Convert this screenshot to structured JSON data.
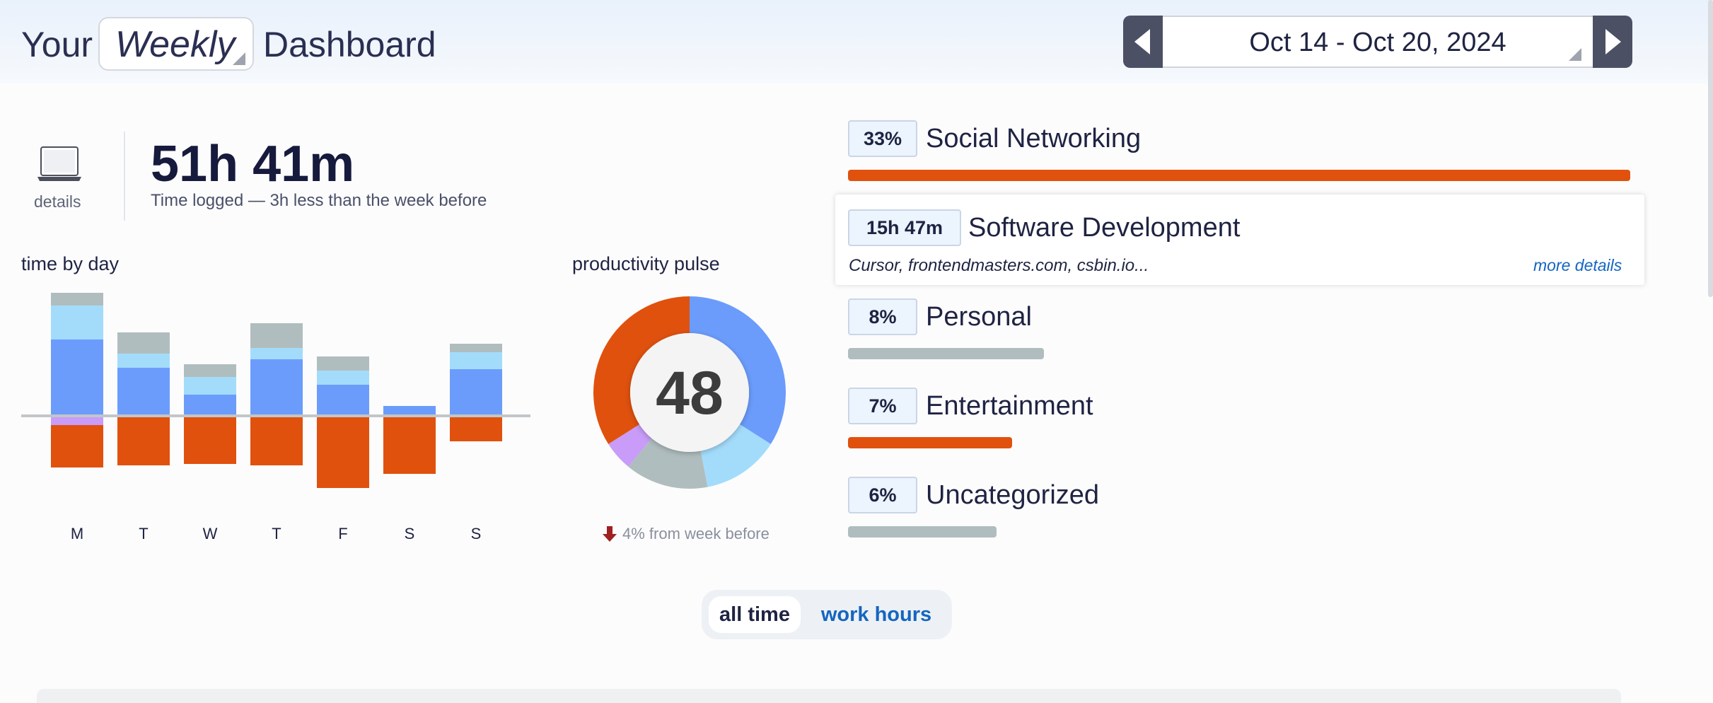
{
  "header": {
    "title_prefix": "Your",
    "period": "Weekly",
    "title_suffix": "Dashboard",
    "date_range": "Oct 14 - Oct 20, 2024",
    "prev_icon": "triangle-left-icon",
    "next_icon": "triangle-right-icon"
  },
  "summary": {
    "details_label": "details",
    "device_icon": "laptop-icon",
    "total_time": "51h 41m",
    "note": "Time logged — 3h less than the week before"
  },
  "time_by_day": {
    "label": "time by day",
    "days": [
      "M",
      "T",
      "W",
      "T",
      "F",
      "S",
      "S"
    ]
  },
  "pulse": {
    "label": "productivity pulse",
    "score": "48",
    "change_note": "4% from week before",
    "change_icon": "arrow-down-icon"
  },
  "colors": {
    "very_productive": "#6b9cfc",
    "productive": "#a3dcfb",
    "neutral": "#b0bdbe",
    "distracting": "#c89cf8",
    "very_distracting": "#e0510e",
    "link": "#1565c0"
  },
  "categories": [
    {
      "value": "33%",
      "name": "Social Networking",
      "level": 1.0,
      "color": "#e0510e"
    },
    {
      "value": "15h 47m",
      "name": "Software Development",
      "apps": "Cursor, frontendmasters.com, csbin.io...",
      "more": "more details"
    },
    {
      "value": "8%",
      "name": "Personal",
      "level": 0.25,
      "color": "#b0bdbe"
    },
    {
      "value": "7%",
      "name": "Entertainment",
      "level": 0.21,
      "color": "#e0510e"
    },
    {
      "value": "6%",
      "name": "Uncategorized",
      "level": 0.19,
      "color": "#b0bdbe"
    }
  ],
  "toggle": {
    "options": [
      "all time",
      "work hours"
    ],
    "selected": "all time"
  },
  "chart_data": [
    {
      "type": "bar",
      "title": "time by day",
      "categories": [
        "M",
        "T",
        "W",
        "T",
        "F",
        "S",
        "S"
      ],
      "series": [
        {
          "key": "very_productive",
          "values": [
            108,
            68,
            30,
            80,
            44,
            14,
            66
          ]
        },
        {
          "key": "productive",
          "values": [
            48,
            20,
            25,
            16,
            20,
            0,
            24
          ]
        },
        {
          "key": "neutral",
          "values": [
            18,
            30,
            18,
            35,
            20,
            0,
            12
          ]
        },
        {
          "key": "distracting",
          "values": [
            -13,
            0,
            0,
            0,
            0,
            0,
            0
          ]
        },
        {
          "key": "very_distracting",
          "values": [
            -60,
            -70,
            -68,
            -70,
            -102,
            -82,
            -36
          ]
        }
      ],
      "baseline": 0
    },
    {
      "type": "pie",
      "title": "productivity pulse",
      "slices": [
        {
          "key": "very_productive",
          "value": 34
        },
        {
          "key": "productive",
          "value": 13
        },
        {
          "key": "neutral",
          "value": 14
        },
        {
          "key": "distracting",
          "value": 5
        },
        {
          "key": "very_distracting",
          "value": 34
        }
      ]
    }
  ]
}
